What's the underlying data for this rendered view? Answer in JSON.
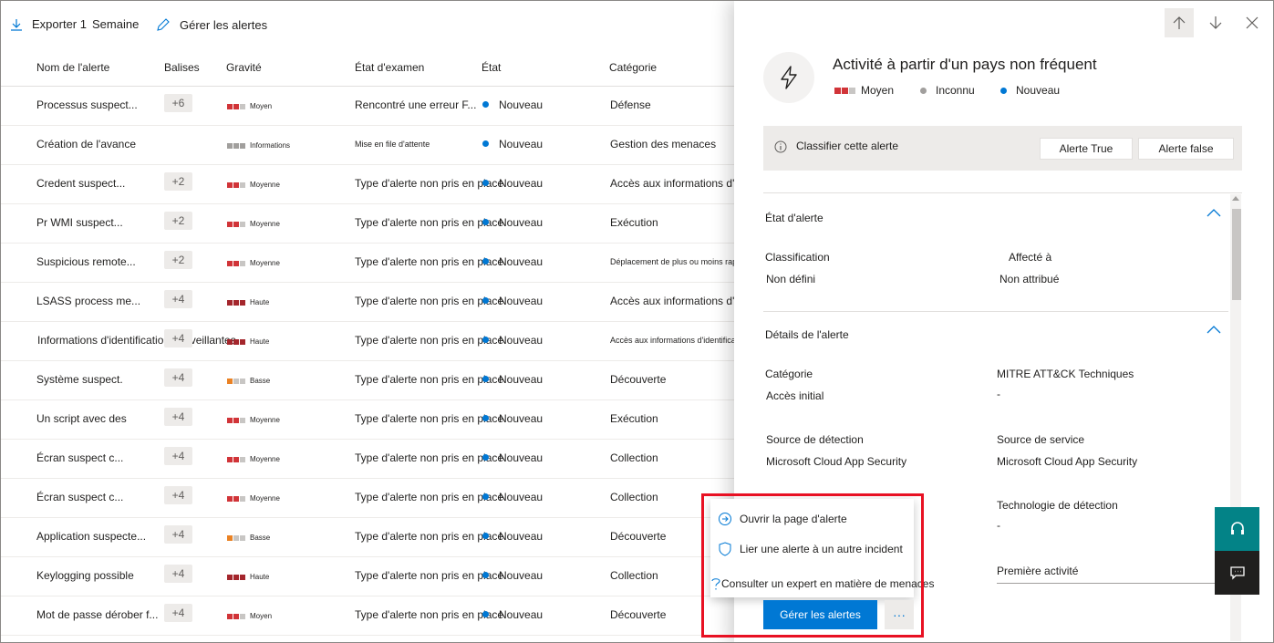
{
  "toolbar": {
    "export_label": "Exporter 1",
    "range_label": "Semaine",
    "manage_label": "Gérer les alertes"
  },
  "table": {
    "headers": [
      "Nom de l'alerte",
      "Balises",
      "Gravité",
      "État d'examen",
      "État",
      "Catégorie"
    ],
    "rows": [
      {
        "name": "Processus suspect...",
        "tags": "+6",
        "severity": "Moyen",
        "sev_colors": [
          "#d13438",
          "#d13438",
          "#c8c6c4"
        ],
        "exam": "Rencontré une erreur F...",
        "exam_small": false,
        "state": "Nouveau",
        "category": "Défense",
        "cat_small": false
      },
      {
        "name": "Création de l'avance",
        "tags": "",
        "severity": "Informations",
        "sev_colors": [
          "#a19f9d",
          "#a19f9d",
          "#a19f9d"
        ],
        "exam": "Mise en file d'attente",
        "exam_small": true,
        "state": "Nouveau",
        "category": "Gestion des menaces",
        "cat_small": false
      },
      {
        "name": "Credent suspect...",
        "tags": "+2",
        "severity": "Moyenne",
        "sev_colors": [
          "#d13438",
          "#d13438",
          "#c8c6c4"
        ],
        "exam": "Type d'alerte non pris en place",
        "exam_small": false,
        "state": "Nouveau",
        "category": "Accès aux informations d'identification",
        "cat_small": false
      },
      {
        "name": "Pr WMI suspect...",
        "tags": "+2",
        "severity": "Moyenne",
        "sev_colors": [
          "#d13438",
          "#d13438",
          "#c8c6c4"
        ],
        "exam": "Type d'alerte non pris en place",
        "exam_small": false,
        "state": "Nouveau",
        "category": "Exécution",
        "cat_small": false
      },
      {
        "name": "Suspicious remote...",
        "tags": "+2",
        "severity": "Moyenne",
        "sev_colors": [
          "#d13438",
          "#d13438",
          "#c8c6c4"
        ],
        "exam": "Type d'alerte non pris en place",
        "exam_small": false,
        "state": "Nouveau",
        "category": "Déplacement de plus ou moins rapide",
        "cat_small": true
      },
      {
        "name": "LSASS process me...",
        "tags": "+4",
        "severity": "Haute",
        "sev_colors": [
          "#a4262c",
          "#a4262c",
          "#a4262c"
        ],
        "exam": "Type d'alerte non pris en place",
        "exam_small": false,
        "state": "Nouveau",
        "category": "Accès aux informations d'identification",
        "cat_small": false
      },
      {
        "name": "Informations d'identification malveillantes",
        "tags": "+4",
        "severity": "Haute",
        "sev_colors": [
          "#a4262c",
          "#a4262c",
          "#a4262c"
        ],
        "exam": "Type d'alerte non pris en place",
        "exam_small": false,
        "state": "Nouveau",
        "category": "Accès aux informations d'identification",
        "cat_small": true
      },
      {
        "name": "Système suspect.",
        "tags": "+4",
        "severity": "Basse",
        "sev_colors": [
          "#ea8224",
          "#c8c6c4",
          "#c8c6c4"
        ],
        "exam": "Type d'alerte non pris en place",
        "exam_small": false,
        "state": "Nouveau",
        "category": "Découverte",
        "cat_small": false
      },
      {
        "name": "Un script avec des",
        "tags": "+4",
        "severity": "Moyenne",
        "sev_colors": [
          "#d13438",
          "#d13438",
          "#c8c6c4"
        ],
        "exam": "Type d'alerte non pris en place",
        "exam_small": false,
        "state": "Nouveau",
        "category": "Exécution",
        "cat_small": false
      },
      {
        "name": "Écran suspect c...",
        "tags": "+4",
        "severity": "Moyenne",
        "sev_colors": [
          "#d13438",
          "#d13438",
          "#c8c6c4"
        ],
        "exam": "Type d'alerte non pris en place",
        "exam_small": false,
        "state": "Nouveau",
        "category": "Collection",
        "cat_small": false
      },
      {
        "name": "Écran suspect c...",
        "tags": "+4",
        "severity": "Moyenne",
        "sev_colors": [
          "#d13438",
          "#d13438",
          "#c8c6c4"
        ],
        "exam": "Type d'alerte non pris en place",
        "exam_small": false,
        "state": "Nouveau",
        "category": "Collection",
        "cat_small": false
      },
      {
        "name": "Application suspecte...",
        "tags": "+4",
        "severity": "Basse",
        "sev_colors": [
          "#ea8224",
          "#c8c6c4",
          "#c8c6c4"
        ],
        "exam": "Type d'alerte non pris en place",
        "exam_small": false,
        "state": "Nouveau",
        "category": "Découverte",
        "cat_small": false
      },
      {
        "name": "Keylogging possible",
        "tags": "+4",
        "severity": "Haute",
        "sev_colors": [
          "#a4262c",
          "#a4262c",
          "#a4262c"
        ],
        "exam": "Type d'alerte non pris en place",
        "exam_small": false,
        "state": "Nouveau",
        "category": "Collection",
        "cat_small": false
      },
      {
        "name": "Mot de passe dérober f...",
        "tags": "+4",
        "severity": "Moyen",
        "sev_colors": [
          "#d13438",
          "#d13438",
          "#c8c6c4"
        ],
        "exam": "Type d'alerte non pris en place",
        "exam_small": false,
        "state": "Nouveau",
        "category": "Découverte",
        "cat_small": false
      }
    ]
  },
  "panel": {
    "title": "Activité à partir d'un pays non fréquent",
    "severity": "Moyen",
    "detection": "Inconnu",
    "status": "Nouveau",
    "classify_text": "Classifier cette alerte",
    "true_btn": "Alerte True",
    "false_btn": "Alerte false",
    "state_section": "État d'alerte",
    "classification_label": "Classification",
    "classification_value": "Non défini",
    "assigned_label": "Affecté à",
    "assigned_value": "Non attribué",
    "details_section": "Détails de l'alerte",
    "category_label": "Catégorie",
    "category_value": "Accès initial",
    "mitre_label": "MITRE ATT&CK Techniques",
    "mitre_value": "-",
    "detection_source_label": "Source de détection",
    "detection_source_value": "Microsoft Cloud App Security",
    "service_source_label": "Source de service",
    "service_source_value": "Microsoft Cloud App Security",
    "detection_tech_label": "Technologie de détection",
    "detection_tech_value": "-",
    "first_activity_label": "Première activité",
    "manage_button": "Gérer les alertes",
    "more_button": "···"
  },
  "menu": {
    "open_page": "Ouvrir la page d'alerte",
    "link_incident": "Lier une alerte à un autre incident",
    "consult_expert": "Consulter un expert en matière de menaces"
  },
  "colors": {
    "accent": "#0078d4",
    "highlight": "#e81123",
    "teal": "#038387"
  }
}
